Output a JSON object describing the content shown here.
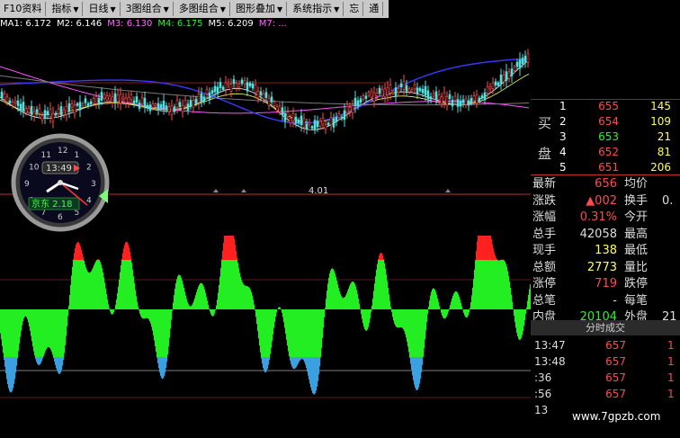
{
  "toolbar": {
    "items": [
      {
        "label": "F10资料",
        "dropdown": false
      },
      {
        "label": "指标",
        "dropdown": true
      },
      {
        "label": "日线",
        "dropdown": true
      },
      {
        "label": "3图组合",
        "dropdown": true
      },
      {
        "label": "多图组合",
        "dropdown": true
      },
      {
        "label": "图形叠加",
        "dropdown": true
      },
      {
        "label": "系统指示",
        "dropdown": true
      },
      {
        "label": "忘",
        "dropdown": false
      },
      {
        "label": "通",
        "dropdown": false
      }
    ]
  },
  "ma_line": [
    {
      "text": "MA1: 6.172",
      "color": "#ffffff"
    },
    {
      "text": "M2: 6.146",
      "color": "#ffffff"
    },
    {
      "text": "M3: 6.130",
      "color": "#ff66ff"
    },
    {
      "text": "M4: 6.175",
      "color": "#33ee33"
    },
    {
      "text": "M5: 6.209",
      "color": "#ffffff"
    },
    {
      "text": "M7: ...",
      "color": "#ff66ff"
    }
  ],
  "main_chart": {
    "low_label": "4.01"
  },
  "clock": {
    "time": "13:49",
    "stock_label": "京东 2.18"
  },
  "order_book": {
    "sell_label": "买",
    "buy_label": "盘",
    "rows": [
      {
        "level": "1",
        "price": "655",
        "volume": "145"
      },
      {
        "level": "2",
        "price": "654",
        "volume": "109"
      },
      {
        "level": "3",
        "price": "653",
        "volume": "21"
      },
      {
        "level": "4",
        "price": "652",
        "volume": "81"
      },
      {
        "level": "5",
        "price": "651",
        "volume": "206"
      }
    ]
  },
  "stats": [
    {
      "label": "最新",
      "value": "656",
      "value_color": "#ff4b4b",
      "label2": "均价",
      "value2": ""
    },
    {
      "label": "涨跌",
      "value": "▲002",
      "value_color": "#ff4b4b",
      "label2": "换手",
      "value2": "0."
    },
    {
      "label": "涨幅",
      "value": "0.31%",
      "value_color": "#ff4b4b",
      "label2": "今开",
      "value2": ""
    },
    {
      "label": "总手",
      "value": "42058",
      "value_color": "#dddddd",
      "label2": "最高",
      "value2": ""
    },
    {
      "label": "现手",
      "value": "138",
      "value_color": "#ffff55",
      "label2": "最低",
      "value2": ""
    },
    {
      "label": "总额",
      "value": "2773",
      "value_color": "#ffff55",
      "label2": "量比",
      "value2": ""
    },
    {
      "label": "涨停",
      "value": "719",
      "value_color": "#ff4b4b",
      "label2": "跌停",
      "value2": ""
    },
    {
      "label": "总笔",
      "value": "-",
      "value_color": "#dddddd",
      "label2": "每笔",
      "value2": ""
    },
    {
      "label": "内盘",
      "value": "20104",
      "value_color": "#33ee33",
      "label2": "外盘",
      "value2": "21"
    }
  ],
  "ticks": {
    "header": "分时成交",
    "rows": [
      {
        "time": "13:47",
        "price": "657",
        "vol": "1"
      },
      {
        "time": "13:48",
        "price": "657",
        "vol": "1"
      },
      {
        "time": ":36",
        "price": "657",
        "vol": "1"
      },
      {
        "time": ":56",
        "price": "657",
        "vol": "1"
      },
      {
        "time": "13",
        "price": "",
        "vol": ""
      }
    ]
  },
  "watermark": "www.7gpzb.com",
  "colors": {
    "price_up": "#ff4b4b",
    "price_down": "#33ee33",
    "panel_bg": "#000000",
    "toolbar_bg": "#c9c9c9"
  }
}
